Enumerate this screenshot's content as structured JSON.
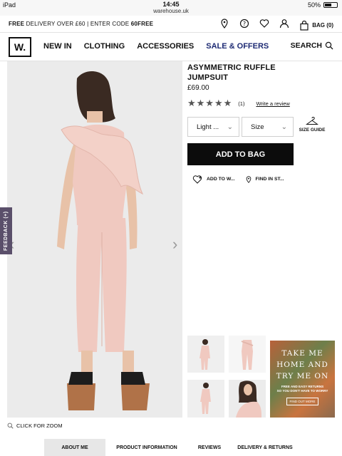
{
  "status": {
    "device": "iPad",
    "time": "14:45",
    "url": "warehouse.uk",
    "battery": "50%"
  },
  "promo": {
    "prefix": "FREE",
    "text": " DELIVERY OVER £60 | ENTER CODE ",
    "code": "60FREE",
    "bag_label": "BAG (0)"
  },
  "nav": {
    "logo": "W.",
    "items": [
      "NEW IN",
      "CLOTHING",
      "ACCESSORIES",
      "SALE & OFFERS"
    ],
    "search_label": "SEARCH"
  },
  "product": {
    "title_line1": "ASYMMETRIC RUFFLE",
    "title_line2": "JUMPSUIT",
    "price": "£69.00",
    "stars": "★★★★★",
    "rating": 5,
    "review_count": "(1)",
    "write_review": "Write a review",
    "colour_select": "Light ...",
    "size_select": "Size",
    "size_guide": "SIZE GUIDE",
    "add_to_bag": "ADD TO BAG",
    "add_to_wishlist": "ADD TO W...",
    "find_in_store": "FIND IN ST..."
  },
  "gallery": {
    "zoom_label": "CLICK FOR ZOOM",
    "feedback_label": "FEEDBACK (+)"
  },
  "promo_tile": {
    "line1": "TAKE ME",
    "line2": "HOME AND",
    "line3": "TRY ME ON",
    "sub1": "FREE AND EASY RETURNS",
    "sub2": "SO YOU DON'T HAVE TO WORRY",
    "button": "FIND OUT MORE"
  },
  "tabs": [
    "ABOUT ME",
    "PRODUCT INFORMATION",
    "REVIEWS",
    "DELIVERY & RETURNS"
  ],
  "colors": {
    "sale": "#1d2a73",
    "feedback": "#5a4f6a",
    "jumpsuit": "#f0c9c0",
    "button": "#0c0c0c"
  }
}
